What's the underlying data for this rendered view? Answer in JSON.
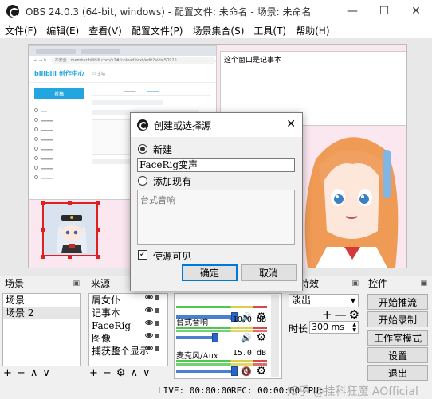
{
  "window": {
    "title": "OBS 24.0.3 (64-bit, windows) - 配置文件: 未命名 - 场景: 未命名",
    "min": "—",
    "max": "☐",
    "close": "✕"
  },
  "menu": [
    "文件(F)",
    "编辑(E)",
    "查看(V)",
    "配置文件(P)",
    "场景集合(S)",
    "工具(T)",
    "帮助(H)"
  ],
  "preview": {
    "browser": {
      "url": "不安全 | member.bilibili.com/v2#/upload/text/edit?aid=50925",
      "logo": "bilibili 创作中心",
      "post_button": "投稿"
    },
    "notepad_text": "这个窗口是记事本"
  },
  "dialog": {
    "title": "创建或选择源",
    "opt_new": "新建",
    "name_value": "FaceRig变声",
    "opt_existing": "添加现有",
    "existing_placeholder": "台式音响",
    "visible_label": "使源可见",
    "check": "✓",
    "ok": "确定",
    "cancel": "取消",
    "close": "✕"
  },
  "scenes": {
    "header": "场景",
    "items": [
      "场景",
      "场景 2"
    ],
    "selected": 1,
    "tools": [
      "+",
      "−",
      "∧",
      "∨"
    ]
  },
  "sources": {
    "header": "来源",
    "items": [
      "屑女仆",
      "记事本",
      "FaceRig",
      "图像",
      "捕获整个显示"
    ],
    "tools": [
      "+",
      "−",
      "⚙",
      "∧",
      "∨"
    ]
  },
  "mixer": {
    "tracks": [
      {
        "name": "",
        "db": ""
      },
      {
        "name": "台式音响",
        "db": "-10.0 dB"
      },
      {
        "name": "麦克风/Aux",
        "db": "15.0 dB"
      }
    ]
  },
  "transitions": {
    "header": "场特效",
    "mode": "淡出",
    "tools": [
      "+",
      "—",
      "⚙"
    ],
    "duration_label": "时长",
    "duration_value": "300 ms"
  },
  "controls": {
    "header": "控件",
    "buttons": [
      "开始推流",
      "开始录制",
      "工作室模式",
      "设置",
      "退出"
    ]
  },
  "status": {
    "live": "LIVE: 00:00:00",
    "rec": "REC: 00:00:00",
    "cpu": "CPU:",
    "watermark": "知乎 @挂科狂魔 AOfficial"
  }
}
